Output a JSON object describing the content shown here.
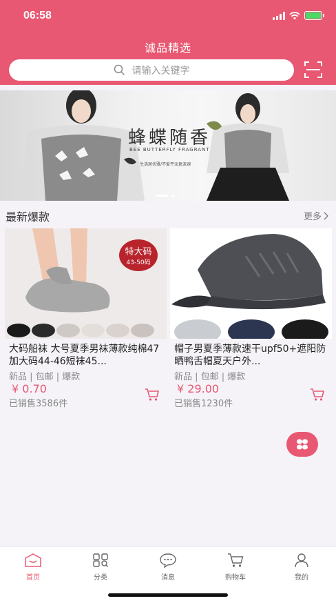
{
  "status_bar": {
    "time": "06:58"
  },
  "header": {
    "title": "诚品精选"
  },
  "search": {
    "placeholder": "请输入关键字"
  },
  "banner": {
    "headline": "蜂蝶随香",
    "sub_en": "BEE BUTTERFLY FRAGRANT",
    "tagline": "生活居优雅/不爱平淡复波澜"
  },
  "section": {
    "title": "最新爆款",
    "more": "更多"
  },
  "products": [
    {
      "badge_main": "特大码",
      "badge_sub": "43-50码",
      "name": "大码船袜 大号夏季男袜薄款纯棉47加大码44-46短袜45...",
      "tags": "新品 | 包邮 | 爆款",
      "price": "¥ 0.70",
      "sold": "已销售3586件"
    },
    {
      "name": "帽子男夏季薄款速干upf50+遮阳防晒鸭舌帽夏天户外...",
      "tags": "新品 | 包邮 | 爆款",
      "price": "¥ 29.00",
      "sold": "已销售1230件"
    }
  ],
  "tabs": [
    {
      "label": "首页",
      "icon": "home-icon"
    },
    {
      "label": "分类",
      "icon": "category-icon"
    },
    {
      "label": "消息",
      "icon": "message-icon"
    },
    {
      "label": "购物车",
      "icon": "cart-icon"
    },
    {
      "label": "我的",
      "icon": "user-icon"
    }
  ],
  "colors": {
    "accent": "#e85872",
    "background": "#f5f3f8"
  }
}
